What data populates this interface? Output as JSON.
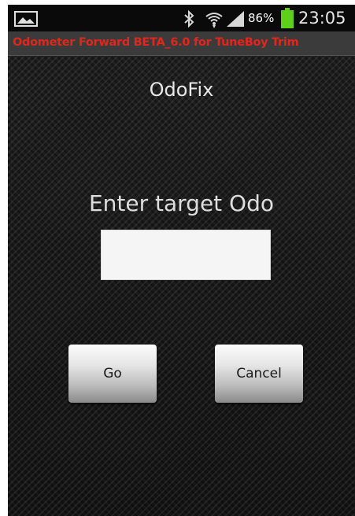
{
  "status_bar": {
    "notification_icon": "gallery-icon",
    "bluetooth_icon": "bluetooth-icon",
    "wifi_icon": "wifi-icon",
    "signal_icon": "signal-icon",
    "battery_percent": "86%",
    "battery_icon": "battery-icon",
    "battery_color": "#5ed01c",
    "time": "23:05"
  },
  "title_bar": {
    "title": "Odometer Forward BETA_6.0 for TuneBoy Trim",
    "title_color": "#e1261c"
  },
  "main": {
    "heading": "OdoFix",
    "prompt": "Enter target Odo",
    "target_input": {
      "value": "",
      "placeholder": ""
    },
    "go_label": "Go",
    "cancel_label": "Cancel"
  }
}
